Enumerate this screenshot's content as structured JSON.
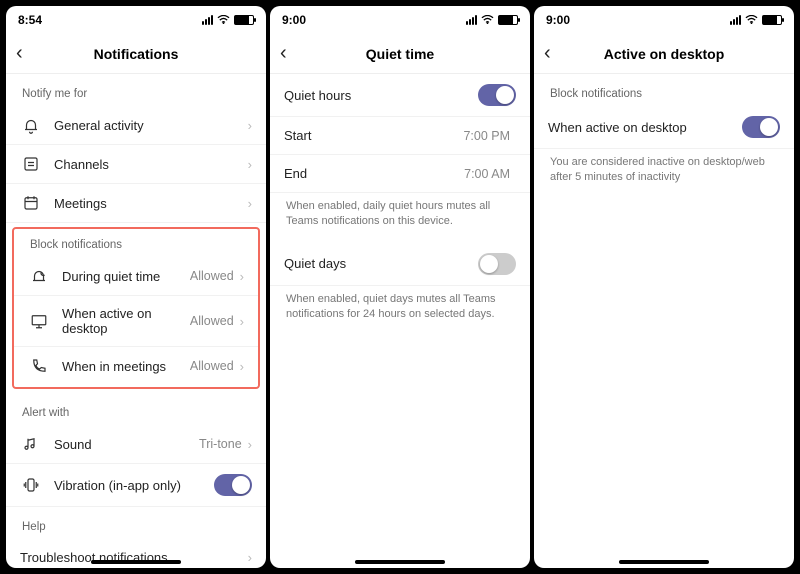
{
  "screens": [
    {
      "status_time": "8:54",
      "title": "Notifications",
      "groups": [
        {
          "label": "Notify me for",
          "rows": [
            {
              "icon": "bell",
              "label": "General activity",
              "chev": true
            },
            {
              "icon": "channels",
              "label": "Channels",
              "chev": true
            },
            {
              "icon": "calendar",
              "label": "Meetings",
              "chev": true
            }
          ]
        }
      ],
      "highlight_group": {
        "label": "Block notifications",
        "rows": [
          {
            "icon": "quiet",
            "label": "During quiet time",
            "value": "Allowed",
            "chev": true
          },
          {
            "icon": "desktop",
            "label": "When active on desktop",
            "value": "Allowed",
            "chev": true
          },
          {
            "icon": "phone",
            "label": "When in meetings",
            "value": "Allowed",
            "chev": true
          }
        ]
      },
      "groups2": [
        {
          "label": "Alert with",
          "rows": [
            {
              "icon": "sound",
              "label": "Sound",
              "value": "Tri-tone",
              "chev": true
            },
            {
              "icon": "vibration",
              "label": "Vibration (in-app only)",
              "toggle": true,
              "toggle_on": true
            }
          ]
        },
        {
          "label": "Help",
          "rows": [
            {
              "label": "Troubleshoot notifications",
              "chev": true
            }
          ]
        }
      ]
    },
    {
      "status_time": "9:00",
      "title": "Quiet time",
      "rows": [
        {
          "label": "Quiet hours",
          "toggle": true,
          "toggle_on": true
        },
        {
          "label": "Start",
          "value": "7:00 PM"
        },
        {
          "label": "End",
          "value": "7:00 AM"
        }
      ],
      "help1": "When enabled, daily quiet hours mutes all Teams notifications on this device.",
      "rows2": [
        {
          "label": "Quiet days",
          "toggle": true,
          "toggle_on": false
        }
      ],
      "help2": "When enabled, quiet days mutes all Teams notifications for 24 hours on selected days."
    },
    {
      "status_time": "9:00",
      "title": "Active on desktop",
      "section_label": "Block notifications",
      "rows": [
        {
          "label": "When active on desktop",
          "toggle": true,
          "toggle_on": true
        }
      ],
      "help": "You are considered inactive on desktop/web after 5 minutes of inactivity"
    }
  ]
}
